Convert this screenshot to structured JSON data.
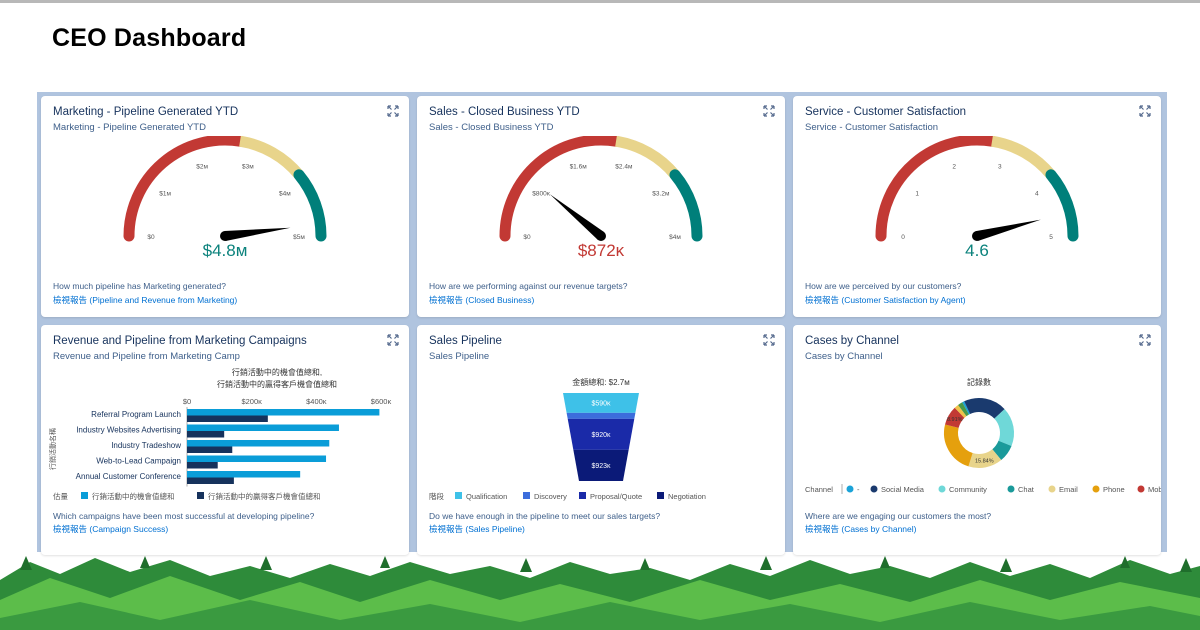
{
  "page": {
    "title": "CEO Dashboard"
  },
  "colors": {
    "red": "#c23934",
    "yellow": "#e8d48b",
    "teal": "#007f7a",
    "link": "#0070d2",
    "navy": "#16325c"
  },
  "cards": {
    "marketing": {
      "title": "Marketing - Pipeline Generated YTD",
      "subtitle": "Marketing - Pipeline Generated YTD",
      "value": "$4.8м",
      "value_color": "#0b827c",
      "gauge": {
        "min": 0,
        "max": 5,
        "current": 4.8
      },
      "ticks": [
        "$0",
        "$1м",
        "$2м",
        "$3м",
        "$4м",
        "$5м"
      ],
      "question": "How much pipeline has Marketing generated?",
      "report_link": "檢視報告 (Pipeline and Revenue from Marketing)"
    },
    "sales": {
      "title": "Sales - Closed Business YTD",
      "subtitle": "Sales - Closed Business YTD",
      "value": "$872κ",
      "value_color": "#c23934",
      "gauge": {
        "min": 0,
        "max": 4,
        "current": 0.872
      },
      "ticks": [
        "$0",
        "$800κ",
        "$1.6м",
        "$2.4м",
        "$3.2м",
        "$4м"
      ],
      "question": "How are we performing against our revenue targets?",
      "report_link": "檢視報告 (Closed Business)"
    },
    "service": {
      "title": "Service - Customer Satisfaction",
      "subtitle": "Service - Customer Satisfaction",
      "value": "4.6",
      "value_color": "#0b827c",
      "gauge": {
        "min": 0,
        "max": 5,
        "current": 4.6
      },
      "ticks": [
        "0",
        "1",
        "2",
        "3",
        "4",
        "5"
      ],
      "question": "How are we perceived by our customers?",
      "report_link": "檢視報告 (Customer Satisfaction by Agent)"
    },
    "campaigns": {
      "title": "Revenue and Pipeline from Marketing Campaigns",
      "subtitle": "Revenue and Pipeline from Marketing Camp",
      "question": "Which campaigns have been most successful at developing pipeline?",
      "report_link": "檢視報告 (Campaign Success)"
    },
    "pipeline": {
      "title": "Sales Pipeline",
      "subtitle": "Sales Pipeline",
      "question": "Do we have enough in the pipeline to meet our sales targets?",
      "report_link": "檢視報告 (Sales Pipeline)"
    },
    "channel": {
      "title": "Cases by Channel",
      "subtitle": "Cases by Channel",
      "question": "Where are we engaging our customers the most?",
      "report_link": "檢視報告 (Cases by Channel)"
    }
  },
  "chart_data": [
    {
      "type": "bar",
      "title_lines": [
        "行銷活動中的機會值總和,",
        "行銷活動中的贏得客戶機會值總和"
      ],
      "ylabel": "行銷活動名稱",
      "categories": [
        "Referral Program Launch",
        "Industry Websites Advertising",
        "Industry Tradeshow",
        "Web-to-Lead Campaign",
        "Annual Customer Conference"
      ],
      "xlim": [
        0,
        600000
      ],
      "x_ticks": [
        "$0",
        "$200κ",
        "$400κ",
        "$600κ"
      ],
      "legend_label": "估量",
      "series": [
        {
          "name": "行銷活動中的機會值總和",
          "color": "#0a9dd8",
          "values": [
            595000,
            470000,
            440000,
            430000,
            350000
          ]
        },
        {
          "name": "行銷活動中的贏得客戶機會值總和",
          "color": "#16325c",
          "values": [
            250000,
            115000,
            140000,
            95000,
            145000
          ]
        }
      ]
    },
    {
      "type": "funnel",
      "title": "金額總和: $2.7м",
      "legend_label": "階段",
      "stages": [
        {
          "name": "Qualification",
          "color": "#3ec1e8",
          "value": 590000,
          "label": "$590κ"
        },
        {
          "name": "Discovery",
          "color": "#3c6ddc",
          "value": 180000,
          "label": ""
        },
        {
          "name": "Proposal/Quote",
          "color": "#1a2aa8",
          "value": 920000,
          "label": "$920κ"
        },
        {
          "name": "Negotiation",
          "color": "#0b1a78",
          "value": 923000,
          "label": "$923κ"
        }
      ]
    },
    {
      "type": "donut",
      "title": "記錄數",
      "legend_label": "Channel",
      "slices": [
        {
          "name": "-",
          "color": "#1ba3d8",
          "value": 1,
          "label": ""
        },
        {
          "name": "Social Media",
          "color": "#1a3a6e",
          "value": 20,
          "label": ""
        },
        {
          "name": "Community",
          "color": "#6fd8d8",
          "value": 18,
          "label": ""
        },
        {
          "name": "Chat",
          "color": "#1a9a9a",
          "value": 8,
          "label": ""
        },
        {
          "name": "Email",
          "color": "#e8d48b",
          "value": 15.84,
          "label": "15.84%"
        },
        {
          "name": "Phone",
          "color": "#e5a00d",
          "value": 24,
          "label": ""
        },
        {
          "name": "Mobil",
          "color": "#c23934",
          "value": 8.91,
          "label": "8.91%"
        },
        {
          "name": "",
          "color": "#f0c34a",
          "value": 2,
          "label": ""
        },
        {
          "name": "",
          "color": "#4a9a4a",
          "value": 2.25,
          "label": ""
        }
      ]
    }
  ]
}
